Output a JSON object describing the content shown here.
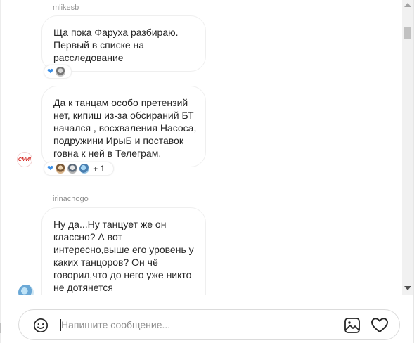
{
  "messages": [
    {
      "username": "mlikesb",
      "text": "Ща пока Фаруха разбираю. Первый в списке на расследование"
    },
    {
      "text": "Да к танцам особо претензий нет, кипиш из-за обсираний БТ начался , восхваления Насоса, подружини ИрыБ и поставок говна к ней в Телеграм.",
      "reactions_more": "+ 1",
      "sender_avatar_text": "СМИ!"
    },
    {
      "username": "irinachogo",
      "text": "Ну да...Ну танцует же он классно? А вот интересно,выше его уровень у каких танцоров? Он чё говорил,что до него уже никто не дотянется"
    }
  ],
  "composer": {
    "placeholder": "Напишите сообщение..."
  },
  "colors": {
    "reaction_heart": "#3b8fe6",
    "bubble_border": "#efefef",
    "muted_text": "#8e8e8e"
  },
  "icons": [
    "emoji-icon",
    "image-icon",
    "heart-icon",
    "reaction-heart-icon"
  ]
}
